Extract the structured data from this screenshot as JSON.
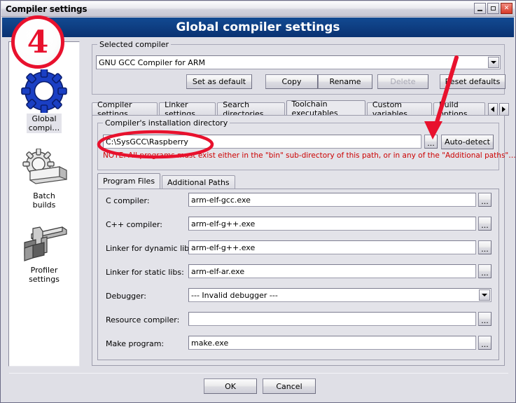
{
  "window": {
    "title": "Compiler settings",
    "banner": "Global compiler settings",
    "minimize_label": "Minimize",
    "maximize_label": "Maximize",
    "close_label": "Close"
  },
  "sidebar": {
    "items": [
      {
        "label": "Global\ncompi…",
        "icon": "blue-gear-icon",
        "selected": true
      },
      {
        "label": "Batch\nbuilds",
        "icon": "gear-stack-icon",
        "selected": false
      },
      {
        "label": "Profiler\nsettings",
        "icon": "caliper-icon",
        "selected": false
      }
    ]
  },
  "selected_compiler": {
    "group_title": "Selected compiler",
    "combo_value": "GNU GCC Compiler for ARM",
    "buttons": [
      {
        "label": "Set as default",
        "disabled": false
      },
      {
        "label": "Copy",
        "disabled": false
      },
      {
        "label": "Rename",
        "disabled": false
      },
      {
        "label": "Delete",
        "disabled": true
      },
      {
        "label": "Reset defaults",
        "disabled": false
      }
    ]
  },
  "main_tabs": {
    "items": [
      {
        "label": "Compiler settings",
        "active": false
      },
      {
        "label": "Linker settings",
        "active": false
      },
      {
        "label": "Search directories",
        "active": false
      },
      {
        "label": "Toolchain executables",
        "active": true
      },
      {
        "label": "Custom variables",
        "active": false
      },
      {
        "label": "Build options",
        "active": false
      }
    ],
    "scroll_left": "◄",
    "scroll_right": "►"
  },
  "install_dir": {
    "group_title": "Compiler's installation directory",
    "value": "C:\\SysGCC\\Raspberry",
    "placeholder": "",
    "browse_label": "...",
    "auto_detect_label": "Auto-detect",
    "note": "NOTE: All programs must exist either in the \"bin\" sub-directory of this path, or in any of the \"Additional paths\"…",
    "note_color": "#cc0000"
  },
  "program_tabs": {
    "items": [
      {
        "label": "Program Files",
        "active": true
      },
      {
        "label": "Additional Paths",
        "active": false
      }
    ]
  },
  "program_files": {
    "browse_label": "...",
    "rows": [
      {
        "label": "C compiler:",
        "value": "arm-elf-gcc.exe",
        "type": "text"
      },
      {
        "label": "C++ compiler:",
        "value": "arm-elf-g++.exe",
        "type": "text"
      },
      {
        "label": "Linker for dynamic libs:",
        "value": "arm-elf-g++.exe",
        "type": "text"
      },
      {
        "label": "Linker for static libs:",
        "value": "arm-elf-ar.exe",
        "type": "text"
      },
      {
        "label": "Debugger:",
        "value": "--- Invalid debugger ---",
        "type": "combo"
      },
      {
        "label": "Resource compiler:",
        "value": "",
        "type": "text"
      },
      {
        "label": "Make program:",
        "value": "make.exe",
        "type": "text"
      }
    ]
  },
  "footer": {
    "ok_label": "OK",
    "cancel_label": "Cancel"
  },
  "annotations": {
    "step_badge": "4",
    "accent_color": "#e8112d"
  }
}
